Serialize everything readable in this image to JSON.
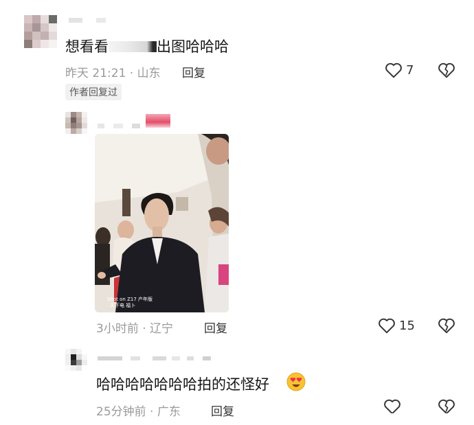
{
  "comments": [
    {
      "text_before": "想看看",
      "text_after": "出图哈哈哈",
      "time_location": "昨天 21:21 · 山东",
      "reply_label": "回复",
      "badge": "作者回复过",
      "like_count": "7"
    },
    {
      "time_location": "3小时前 · 辽宁",
      "reply_label": "回复",
      "like_count": "15",
      "photo_caption_1": "Shot on Z17 产年版",
      "photo_caption_2": "天下电 福卜"
    },
    {
      "text": "哈哈哈哈哈哈哈拍的还怪好",
      "time_location": "25分钟前 · 广东",
      "reply_label": "回复"
    }
  ],
  "icons": {
    "like": "heart-outline-icon",
    "dislike": "broken-heart-icon",
    "emoji": "heart-eyes-emoji-icon"
  }
}
